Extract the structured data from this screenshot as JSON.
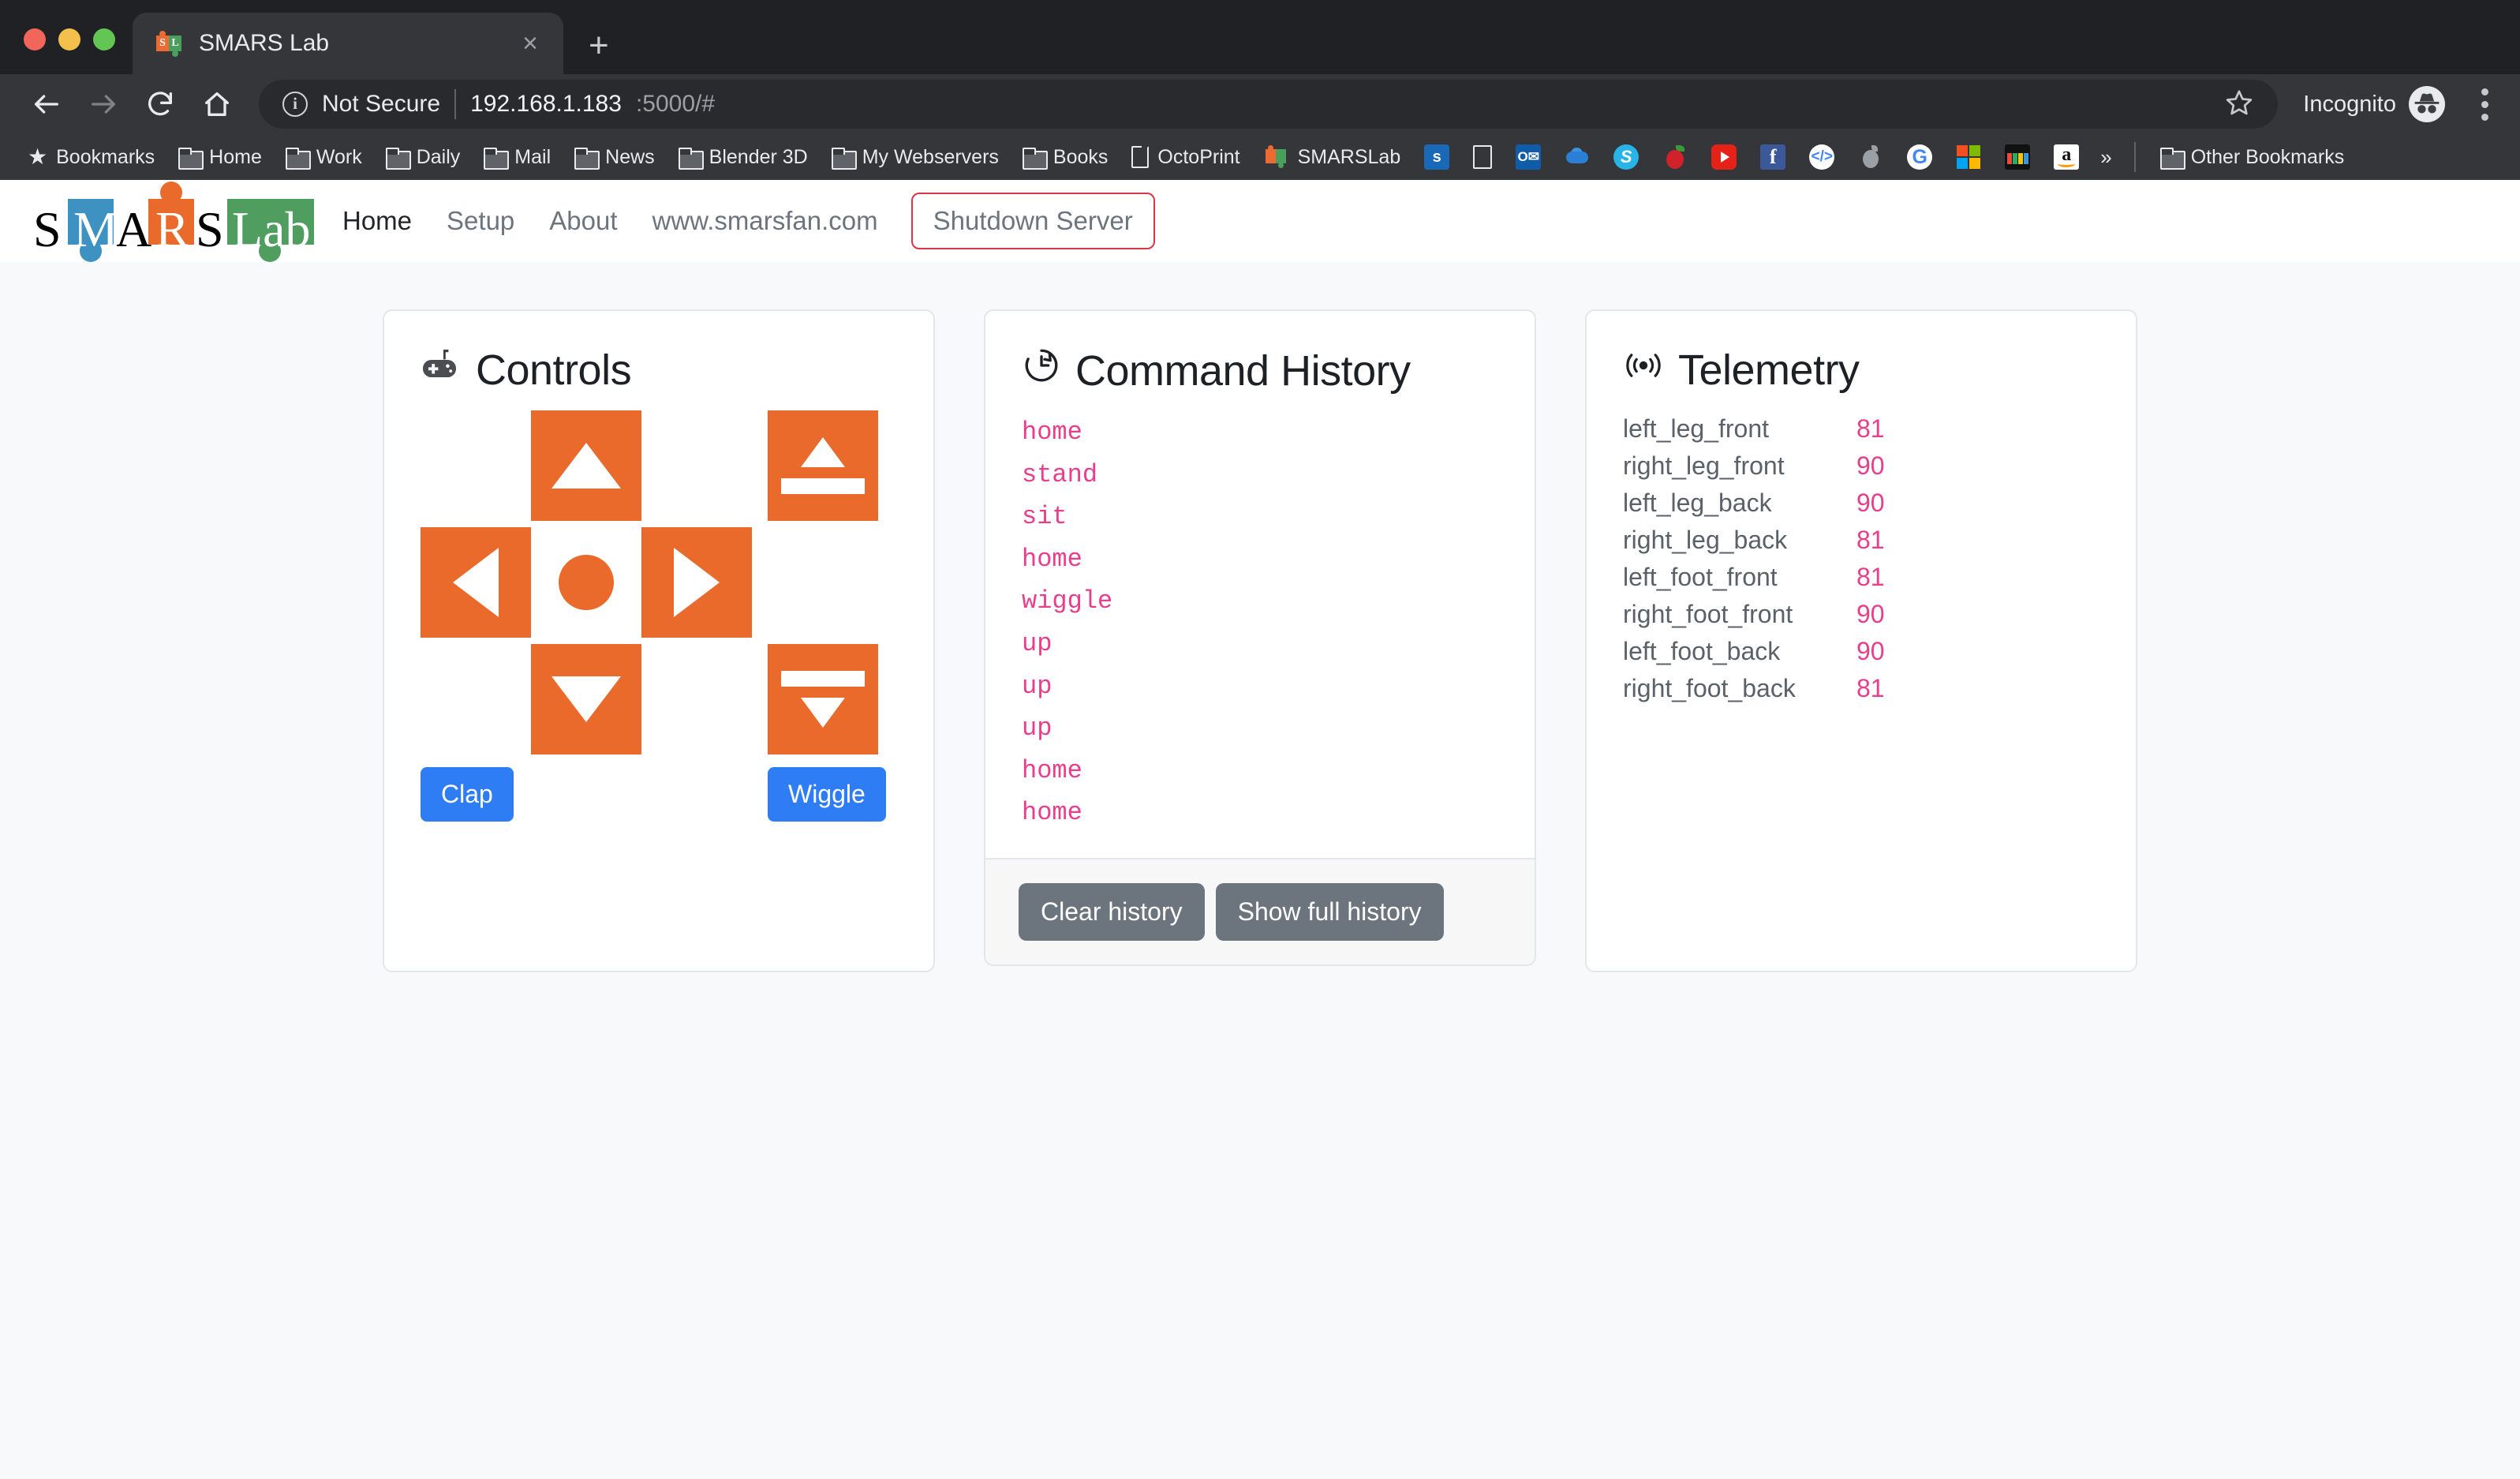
{
  "browser": {
    "tab": {
      "title": "SMARS Lab",
      "favicon": "smarslab-icon",
      "close": "×"
    },
    "new_tab": "+",
    "nav": {
      "back": "back-arrow-icon",
      "forward": "forward-arrow-icon",
      "reload": "reload-icon",
      "home": "home-icon"
    },
    "omnibox": {
      "security_icon": "info-circle-icon",
      "security_label": "Not Secure",
      "url_host": "192.168.1.183",
      "url_rest": ":5000/#",
      "star": "bookmark-star-icon"
    },
    "profile": {
      "label": "Incognito",
      "icon": "incognito-icon"
    },
    "menu": "kebab-menu-icon",
    "bookmarks": [
      {
        "label": "Bookmarks",
        "icon": "star-icon"
      },
      {
        "label": "Home",
        "icon": "folder-icon"
      },
      {
        "label": "Work",
        "icon": "folder-icon"
      },
      {
        "label": "Daily",
        "icon": "folder-icon"
      },
      {
        "label": "Mail",
        "icon": "folder-icon"
      },
      {
        "label": "News",
        "icon": "folder-icon"
      },
      {
        "label": "Blender 3D",
        "icon": "folder-icon"
      },
      {
        "label": "My Webservers",
        "icon": "folder-icon"
      },
      {
        "label": "Books",
        "icon": "folder-icon"
      },
      {
        "label": "OctoPrint",
        "icon": "document-icon"
      },
      {
        "label": "SMARSLab",
        "icon": "smarslab-icon"
      }
    ],
    "bookmark_icons": [
      "sharepoint-icon",
      "document-icon",
      "outlook-icon",
      "onedrive-icon",
      "skype-icon",
      "apple-red-icon",
      "youtube-icon",
      "facebook-icon",
      "google-developers-icon",
      "apple-icon",
      "google-icon",
      "microsoft-icon",
      "shopping-bag-icon",
      "amazon-icon"
    ],
    "overflow": "»",
    "other_bookmarks": {
      "label": "Other Bookmarks",
      "icon": "folder-icon"
    }
  },
  "site": {
    "logo": {
      "letters": [
        "S",
        "M",
        "A",
        "R",
        "S",
        "Lab"
      ],
      "colors": {
        "blue": "#3d92c2",
        "orange": "#ea6a2b",
        "green": "#4f9e5f",
        "black": "#000000"
      }
    },
    "nav": [
      {
        "label": "Home",
        "active": true
      },
      {
        "label": "Setup",
        "active": false
      },
      {
        "label": "About",
        "active": false
      },
      {
        "label": "www.smarsfan.com",
        "active": false
      }
    ],
    "shutdown_button": "Shutdown Server"
  },
  "controls": {
    "title": "Controls",
    "icon": "gamepad-icon",
    "dpad": {
      "up": "forward-arrow-button",
      "down": "backward-arrow-button",
      "left": "turn-left-button",
      "right": "turn-right-button",
      "center": "home-stop-button"
    },
    "posture": {
      "stand": "stand-up-button",
      "sit": "sit-down-button"
    },
    "clap_button": "Clap",
    "wiggle_button": "Wiggle",
    "accent_color": "#ea6a2b",
    "button_color": "#2f7df4"
  },
  "command_history": {
    "title": "Command History",
    "icon": "history-clock-icon",
    "items": [
      "home",
      "stand",
      "sit",
      "home",
      "wiggle",
      "up",
      "up",
      "up",
      "home",
      "home"
    ],
    "clear_button": "Clear history",
    "show_full_button": "Show full history",
    "text_color": "#e83e8c"
  },
  "telemetry": {
    "title": "Telemetry",
    "icon": "broadcast-signal-icon",
    "rows": [
      {
        "name": "left_leg_front",
        "value": "81"
      },
      {
        "name": "right_leg_front",
        "value": "90"
      },
      {
        "name": "left_leg_back",
        "value": "90"
      },
      {
        "name": "right_leg_back",
        "value": "81"
      },
      {
        "name": "left_foot_front",
        "value": "81"
      },
      {
        "name": "right_foot_front",
        "value": "90"
      },
      {
        "name": "left_foot_back",
        "value": "90"
      },
      {
        "name": "right_foot_back",
        "value": "81"
      }
    ],
    "value_color": "#e83e8c"
  }
}
